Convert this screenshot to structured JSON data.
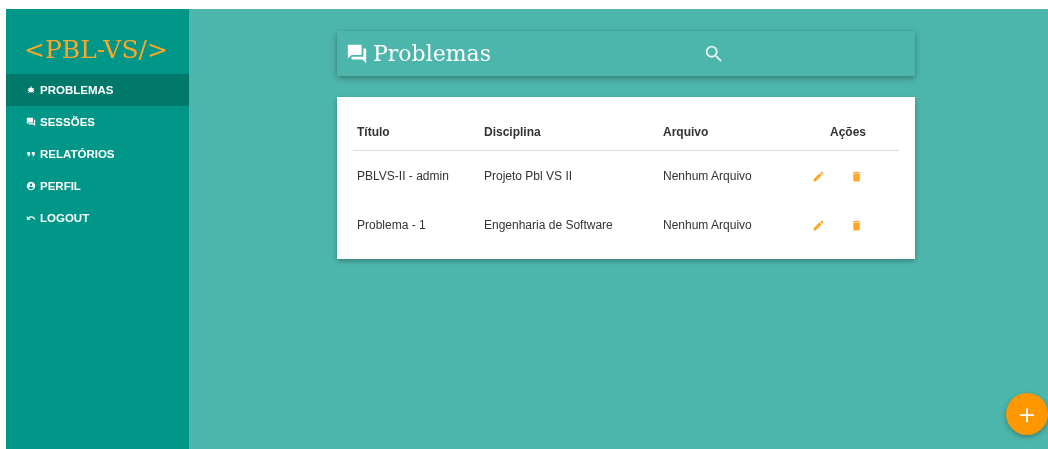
{
  "logo": "<PBL-VS/>",
  "sidebar": {
    "items": [
      {
        "label": "PROBLEMAS",
        "selected": true
      },
      {
        "label": "SESSÕES",
        "selected": false
      },
      {
        "label": "RELATÓRIOS",
        "selected": false
      },
      {
        "label": "PERFIL",
        "selected": false
      },
      {
        "label": "LOGOUT",
        "selected": false
      }
    ]
  },
  "header": {
    "title": "Problemas"
  },
  "table": {
    "columns": [
      "Título",
      "Disciplina",
      "Arquivo",
      "Ações"
    ],
    "rows": [
      {
        "titulo": "PBLVS-II - admin",
        "disciplina": "Projeto Pbl VS II",
        "arquivo": "Nenhum Arquivo"
      },
      {
        "titulo": "Problema - 1",
        "disciplina": "Engenharia de Software",
        "arquivo": "Nenhum Arquivo"
      }
    ]
  },
  "fab": "+"
}
